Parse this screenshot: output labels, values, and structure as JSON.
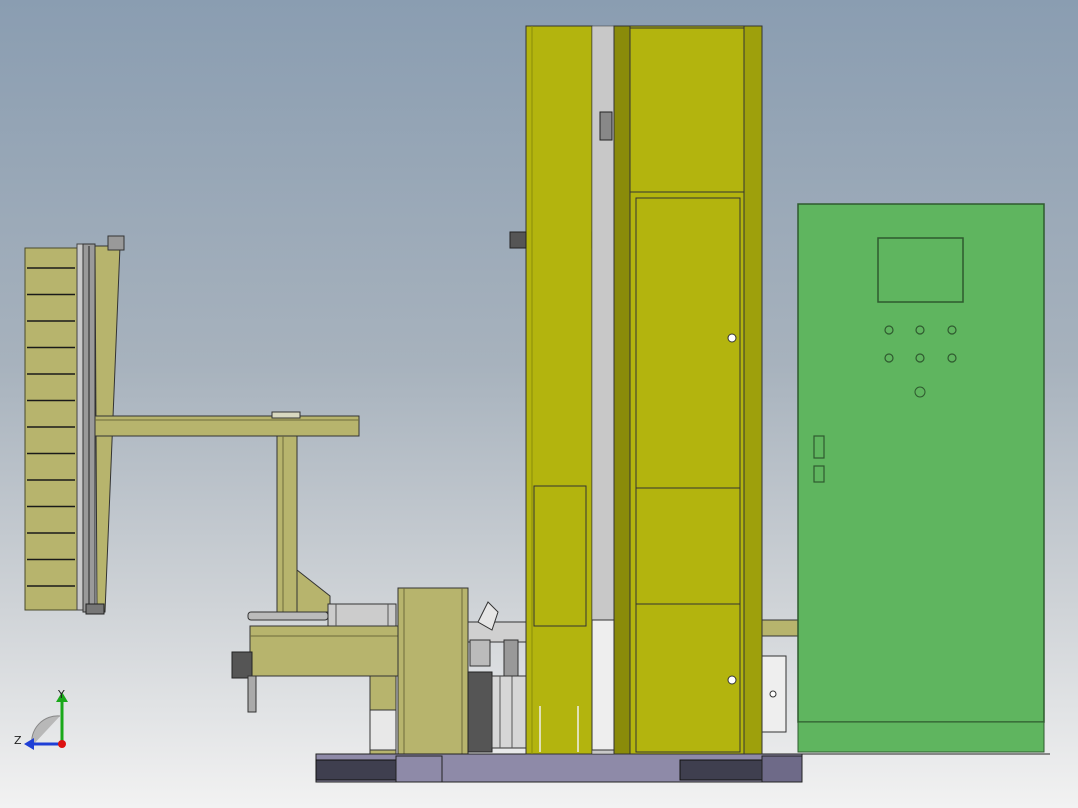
{
  "viewport": {
    "background_top": "#8a9db1",
    "background_bottom": "#f2f2f2"
  },
  "colors": {
    "frame_yellow": "#b3b40e",
    "frame_yellow_dark": "#8a8b0a",
    "olive_panel": "#b7b46d",
    "olive_dark": "#8d8a4f",
    "cabinet_green": "#5fb55f",
    "cabinet_outline": "#2f5a2f",
    "base_purple": "#8e8aa8",
    "base_dark": "#3f3f4f",
    "machine_gray": "#c8c8c8"
  },
  "triad": {
    "y_label": "Y",
    "z_label": "Z",
    "y_color": "#1aa81a",
    "z_color": "#1f3fd6",
    "origin_color": "#d11"
  },
  "icons": {
    "axis_triad": "axis-triad-icon"
  }
}
